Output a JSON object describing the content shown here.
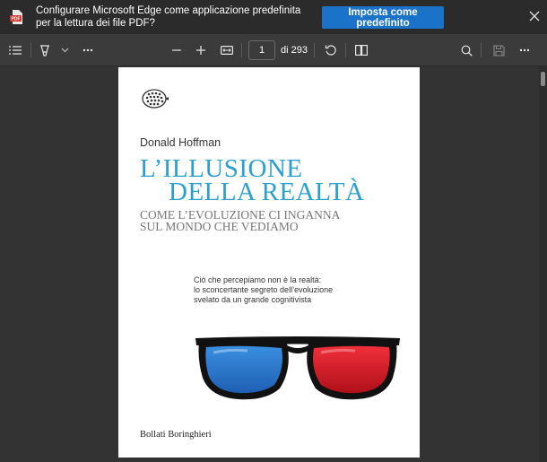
{
  "banner": {
    "message": "Configurare Microsoft Edge come applicazione predefinita per la lettura dei file PDF?",
    "pdf_badge": "PDF",
    "button_label": "Imposta come predefinito",
    "accent": "#1a73c9"
  },
  "toolbar": {
    "page_current": "1",
    "page_total": "di 293",
    "icons": [
      "contents-icon",
      "draw-icon",
      "chevron-down-icon",
      "more-icon",
      "zoom-out-icon",
      "zoom-in-icon",
      "fit-page-icon",
      "rotate-icon",
      "page-view-icon",
      "search-icon",
      "save-icon",
      "more-options-icon"
    ]
  },
  "document": {
    "author": "Donald Hoffman",
    "title_line1": "L’ILLUSIONE",
    "title_line2": "DELLA REALTÀ",
    "subtitle_line1": "COME L’EVOLUZIONE CI INGANNA",
    "subtitle_line2": "SUL MONDO CHE VEDIAMO",
    "blurb_line1": "Ciò che percepiamo non è la realtà:",
    "blurb_line2": "lo sconcertante segreto dell’evoluzione",
    "blurb_line3": "svelato da un grande cognitivista",
    "publisher": "Bollati Boringhieri",
    "title_color": "#2a9fd0"
  }
}
